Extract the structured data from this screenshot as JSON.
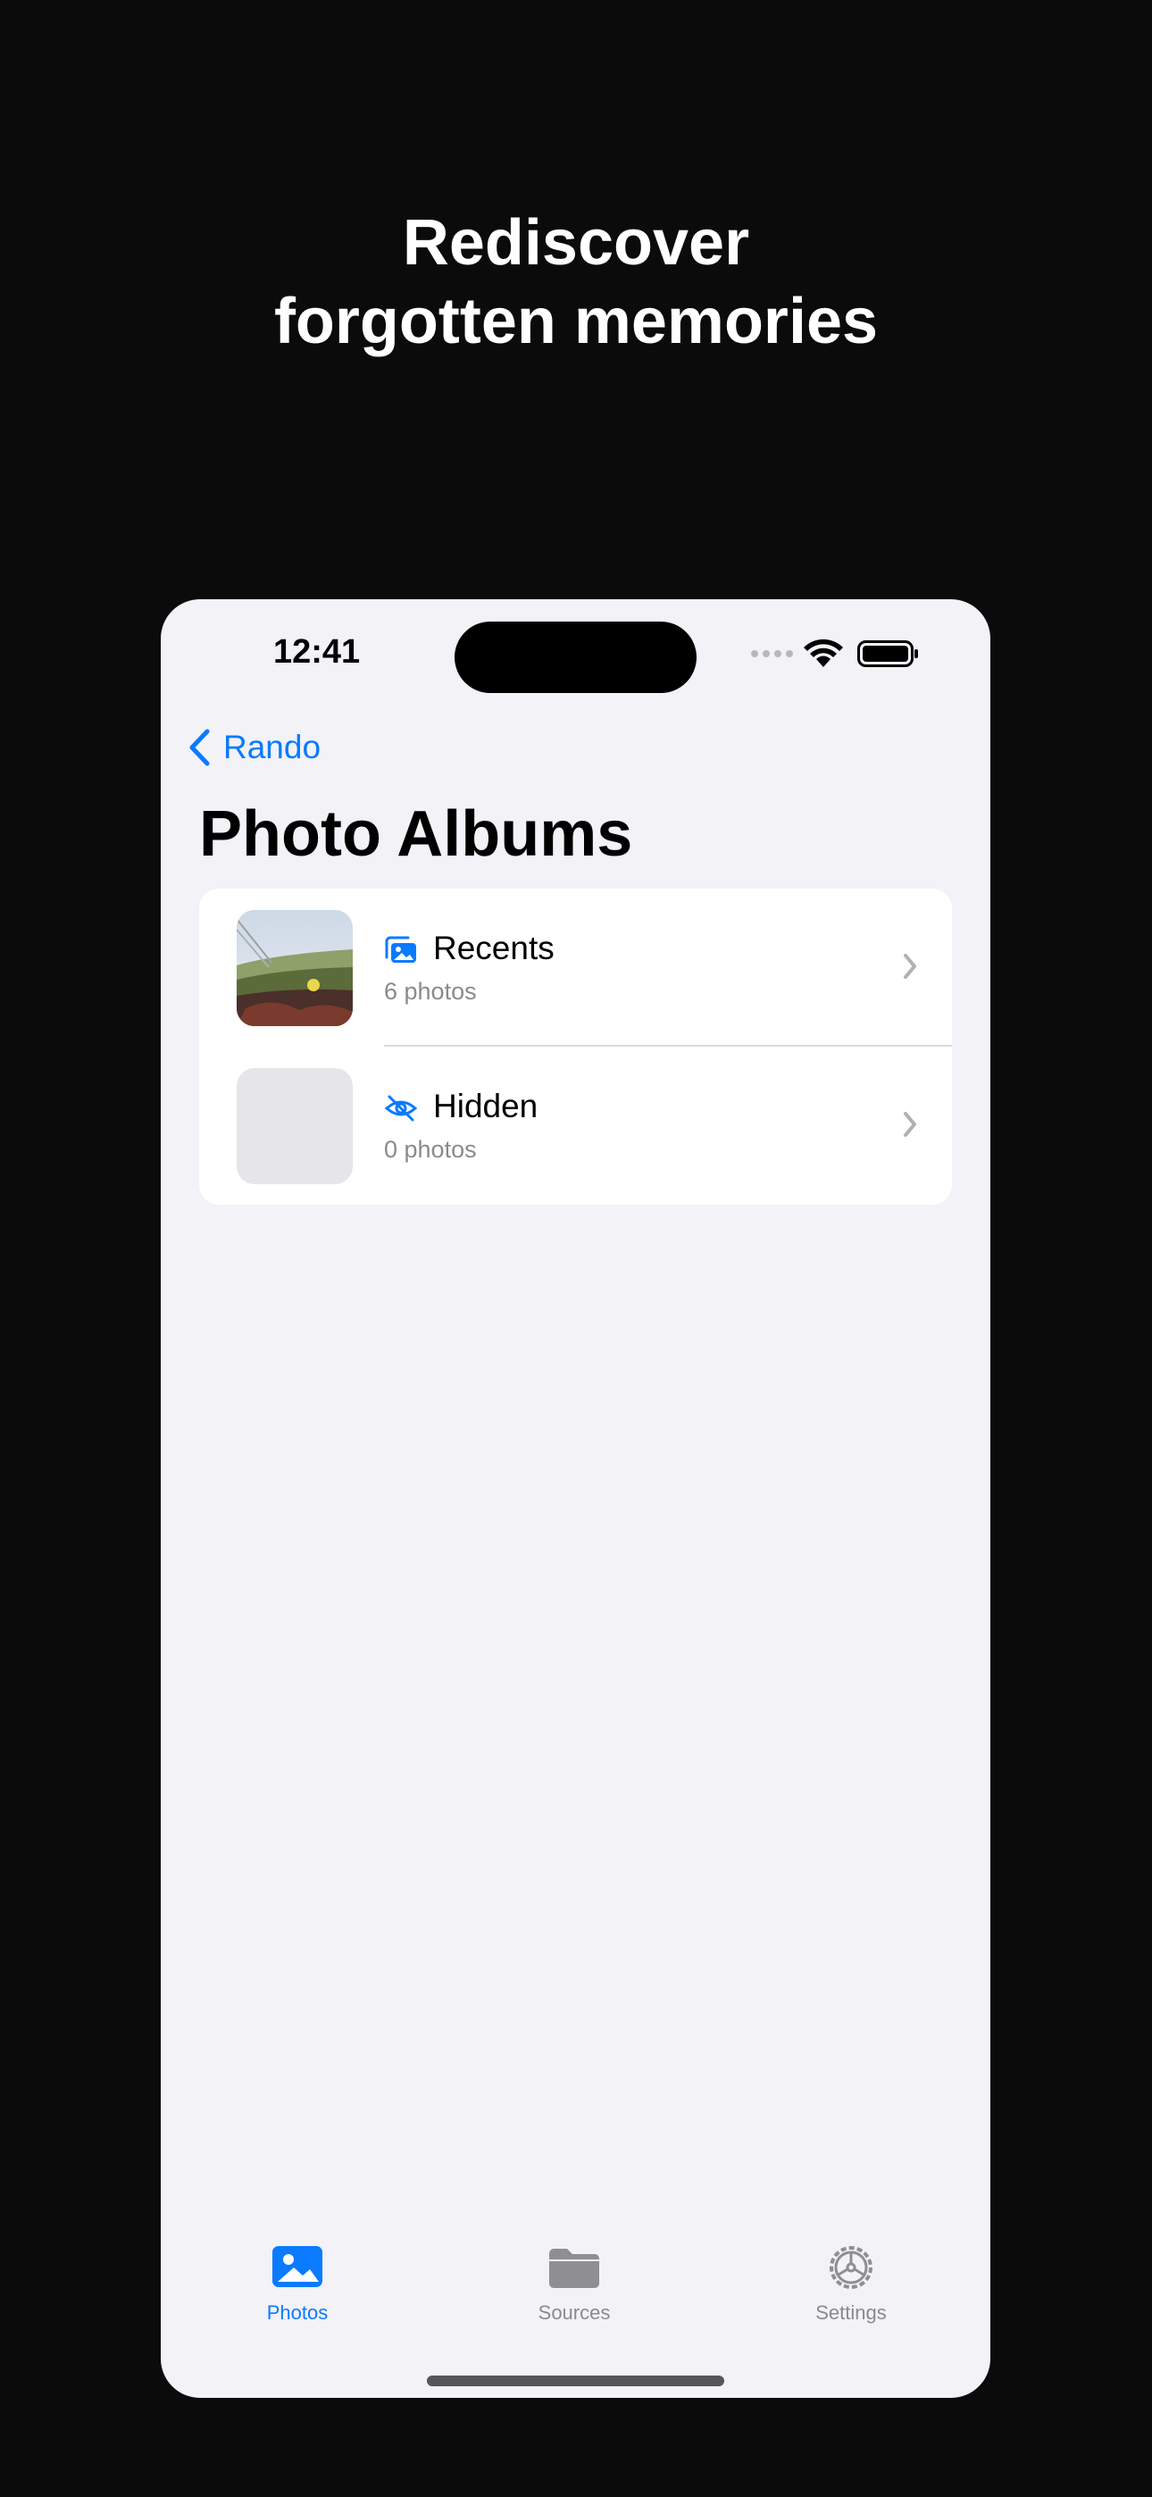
{
  "headline": {
    "line1": "Rediscover",
    "line2": "forgotten memories"
  },
  "status_bar": {
    "time": "12:41",
    "icons": [
      "signal-icon",
      "wifi-icon",
      "battery-icon"
    ]
  },
  "nav": {
    "back_label": "Rando",
    "title": "Photo Albums"
  },
  "albums": [
    {
      "title": "Recents",
      "subtitle": "6 photos",
      "icon": "photo-stack-icon"
    },
    {
      "title": "Hidden",
      "subtitle": "0 photos",
      "icon": "eye-slash-icon"
    }
  ],
  "tabs": [
    {
      "label": "Photos",
      "icon": "photo-icon",
      "active": true
    },
    {
      "label": "Sources",
      "icon": "folder-icon",
      "active": false
    },
    {
      "label": "Settings",
      "icon": "gear-icon",
      "active": false
    }
  ],
  "colors": {
    "background": "#0b0b0c",
    "screen": "#f2f2f7",
    "accent": "#0a7aff",
    "secondary_text": "#8a8a8e"
  }
}
